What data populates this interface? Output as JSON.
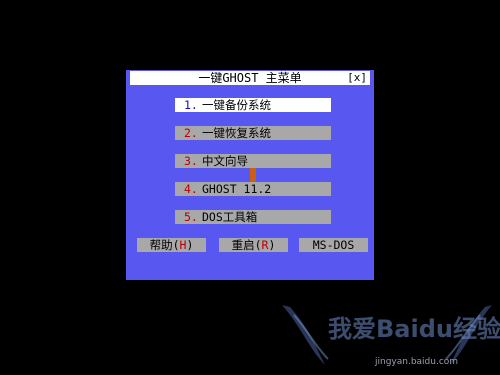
{
  "dialog": {
    "title": "一键GHOST 主菜单",
    "close_label": "[x]"
  },
  "menu": [
    {
      "number": "1.",
      "label": "一键备份系统",
      "selected": true
    },
    {
      "number": "2.",
      "label": "一键恢复系统",
      "selected": false
    },
    {
      "number": "3.",
      "label": "中文向导",
      "selected": false
    },
    {
      "number": "4.",
      "label": "GHOST 11.2",
      "selected": false
    },
    {
      "number": "5.",
      "label": "DOS工具箱",
      "selected": false
    }
  ],
  "buttons": {
    "help": {
      "label": "帮助(",
      "hotkey": "H",
      "suffix": ")"
    },
    "restart": {
      "label": "重启(",
      "hotkey": "R",
      "suffix": ")"
    },
    "msdos": {
      "label": "MS-DOS"
    }
  },
  "watermark": {
    "logo": "我爱Baidu经验",
    "url": "jingyan.baidu.com"
  },
  "colors": {
    "background": "#000000",
    "dialog": "#5858f0",
    "item": "#a8a8a8",
    "selected_item": "#ffffff",
    "hotkey": "#b80000",
    "cursor": "#c86010"
  }
}
